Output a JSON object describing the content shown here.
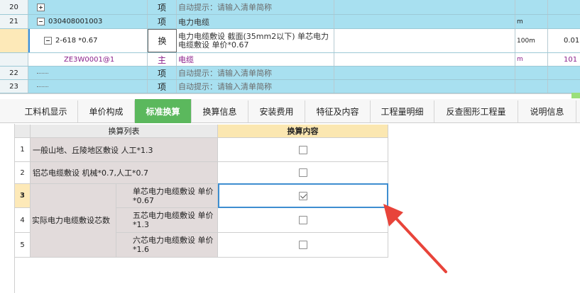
{
  "grid": {
    "rows": [
      {
        "num": "20",
        "code": "",
        "type": "项",
        "name": "自动提示：请输入清单简称",
        "unit": "",
        "qty": "",
        "style": "blue",
        "expander": "plus",
        "hint": true
      },
      {
        "num": "21",
        "code": "030408001003",
        "type": "项",
        "name": "电力电缆",
        "unit": "m",
        "qty": "",
        "style": "blue",
        "expander": "minus",
        "hint": false
      },
      {
        "num": "",
        "code": "2-618 *0.67",
        "type": "换",
        "name": "电力电缆敷设 截面(35mm2以下) 单芯电力电缆敷设 单价*0.67",
        "unit": "100m",
        "qty": "0.01",
        "style": "sel",
        "expander": "minus",
        "hint": false
      },
      {
        "num": "",
        "code": "ZE3W0001@1",
        "type": "主",
        "name": "电缆",
        "unit": "m",
        "qty": "101",
        "style": "white",
        "expander": "",
        "hint": false
      },
      {
        "num": "22",
        "code": "",
        "type": "项",
        "name": "自动提示：请输入清单简称",
        "unit": "",
        "qty": "",
        "style": "blue",
        "expander": "",
        "hint": true
      },
      {
        "num": "23",
        "code": "",
        "type": "项",
        "name": "自动提示：请输入清单简称",
        "unit": "",
        "qty": "",
        "style": "blue",
        "expander": "",
        "hint": true
      }
    ]
  },
  "tabs": [
    {
      "label": "工料机显示",
      "active": false
    },
    {
      "label": "单价构成",
      "active": false
    },
    {
      "label": "标准换算",
      "active": true
    },
    {
      "label": "换算信息",
      "active": false
    },
    {
      "label": "安装费用",
      "active": false
    },
    {
      "label": "特征及内容",
      "active": false
    },
    {
      "label": "工程量明细",
      "active": false
    },
    {
      "label": "反查图形工程量",
      "active": false
    },
    {
      "label": "说明信息",
      "active": false
    }
  ],
  "conversion": {
    "header_list": "换算列表",
    "header_content": "换算内容",
    "rows": [
      {
        "num": "1",
        "label": "一般山地、丘陵地区敷设 人工*1.3",
        "checked": false
      },
      {
        "num": "2",
        "label": "铝芯电缆敷设 机械*0.7,人工*0.7",
        "checked": false
      },
      {
        "num": "3",
        "label": "单芯电力电缆敷设 单价*0.67",
        "checked": true
      },
      {
        "num": "4",
        "label": "五芯电力电缆敷设 单价*1.3",
        "checked": false
      },
      {
        "num": "5",
        "label": "六芯电力电缆敷设 单价*1.6",
        "checked": false
      }
    ],
    "group_label": "实际电力电缆敷设芯数"
  },
  "colors": {
    "row_blue": "#a8e0f0",
    "tab_active": "#5bb85d",
    "header_content": "#fbe7b1",
    "arrow": "#e8443a"
  }
}
